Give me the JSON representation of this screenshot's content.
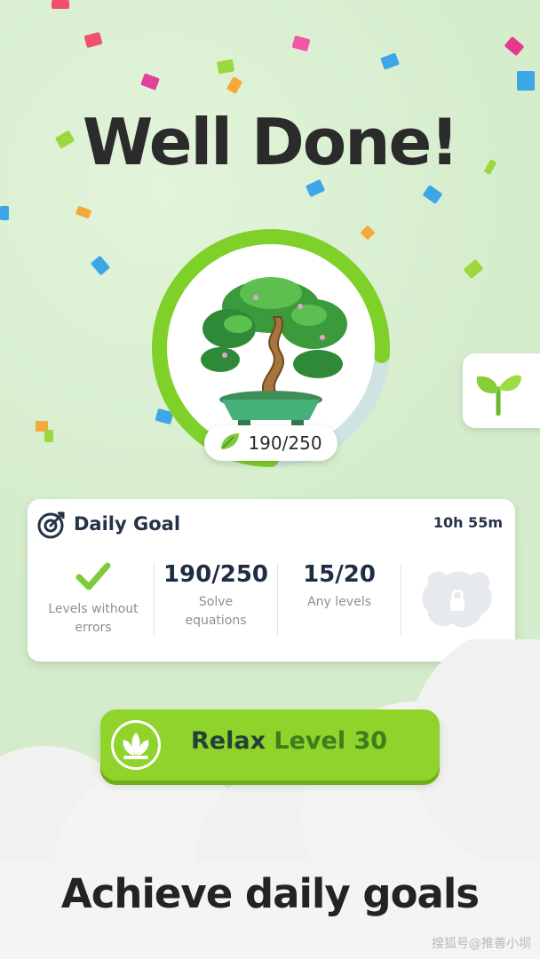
{
  "header": {
    "title": "Well Done!"
  },
  "progress": {
    "count_text": "190/250",
    "fraction": 0.76
  },
  "daily_goal": {
    "title": "Daily Goal",
    "timer": "10h 55m",
    "items": [
      {
        "value": "",
        "label_line1": "Levels without",
        "label_line2": "errors",
        "completed": true
      },
      {
        "value": "190/250",
        "label_line1": "Solve",
        "label_line2": "equations"
      },
      {
        "value": "15/20",
        "label_line1": "Any levels",
        "label_line2": ""
      }
    ]
  },
  "relax_button": {
    "label": "Relax",
    "level": "Level 30"
  },
  "tagline": "Achieve daily goals",
  "watermark": "搜狐号@推善小坝",
  "colors": {
    "accent_green": "#8fd32b",
    "ring_track": "#cfe3e3",
    "background": "#d8efd0"
  },
  "icons": [
    "leaf-icon",
    "target-icon",
    "check-icon",
    "lock-icon",
    "lotus-icon",
    "sprout-icon",
    "bonsai-tree"
  ]
}
